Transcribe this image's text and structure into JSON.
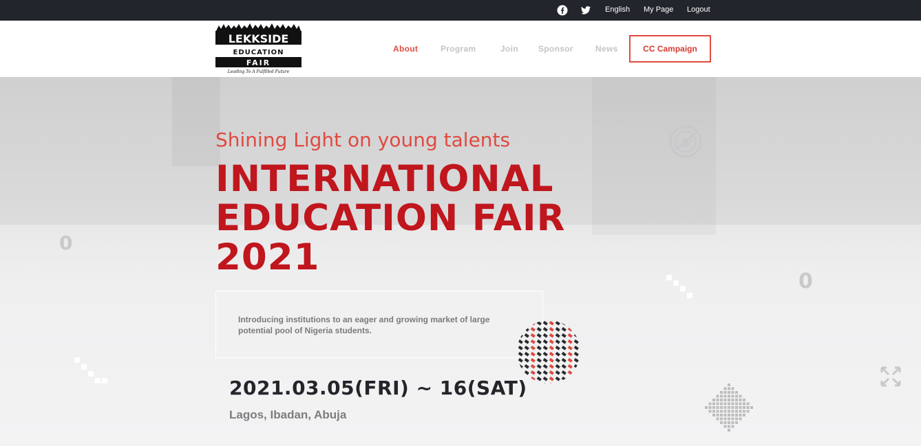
{
  "topbar": {
    "social": [
      {
        "icon": "facebook-icon"
      },
      {
        "icon": "twitter-icon"
      }
    ],
    "links": {
      "english": "English",
      "my_page": "My Page",
      "logout": "Logout"
    }
  },
  "logo": {
    "line1": "LEKKSIDE",
    "line2": "EDUCATION",
    "line3": "FAIR",
    "tagline": "Leading To A Fulfilled Future"
  },
  "nav": {
    "about": "About",
    "program": "Program",
    "join": "Join",
    "sponsor": "Sponsor",
    "news": "News",
    "cta": "CC Campaign"
  },
  "hero": {
    "tagline": "Shining Light on young talents",
    "title_line1": "INTERNATIONAL",
    "title_line2": "EDUCATION FAIR",
    "title_line3": "2021",
    "description": "Introducing institutions to an eager and growing market of large potential pool of Nigeria students.",
    "date": "2021.03.05(FRI) ~ 16(SAT)",
    "cities": "Lagos, Ibadan, Abuja"
  },
  "colors": {
    "accent": "#e04a3f",
    "title_red": "#c0161d",
    "topbar_bg": "#22252c",
    "date_text": "#24252b"
  }
}
